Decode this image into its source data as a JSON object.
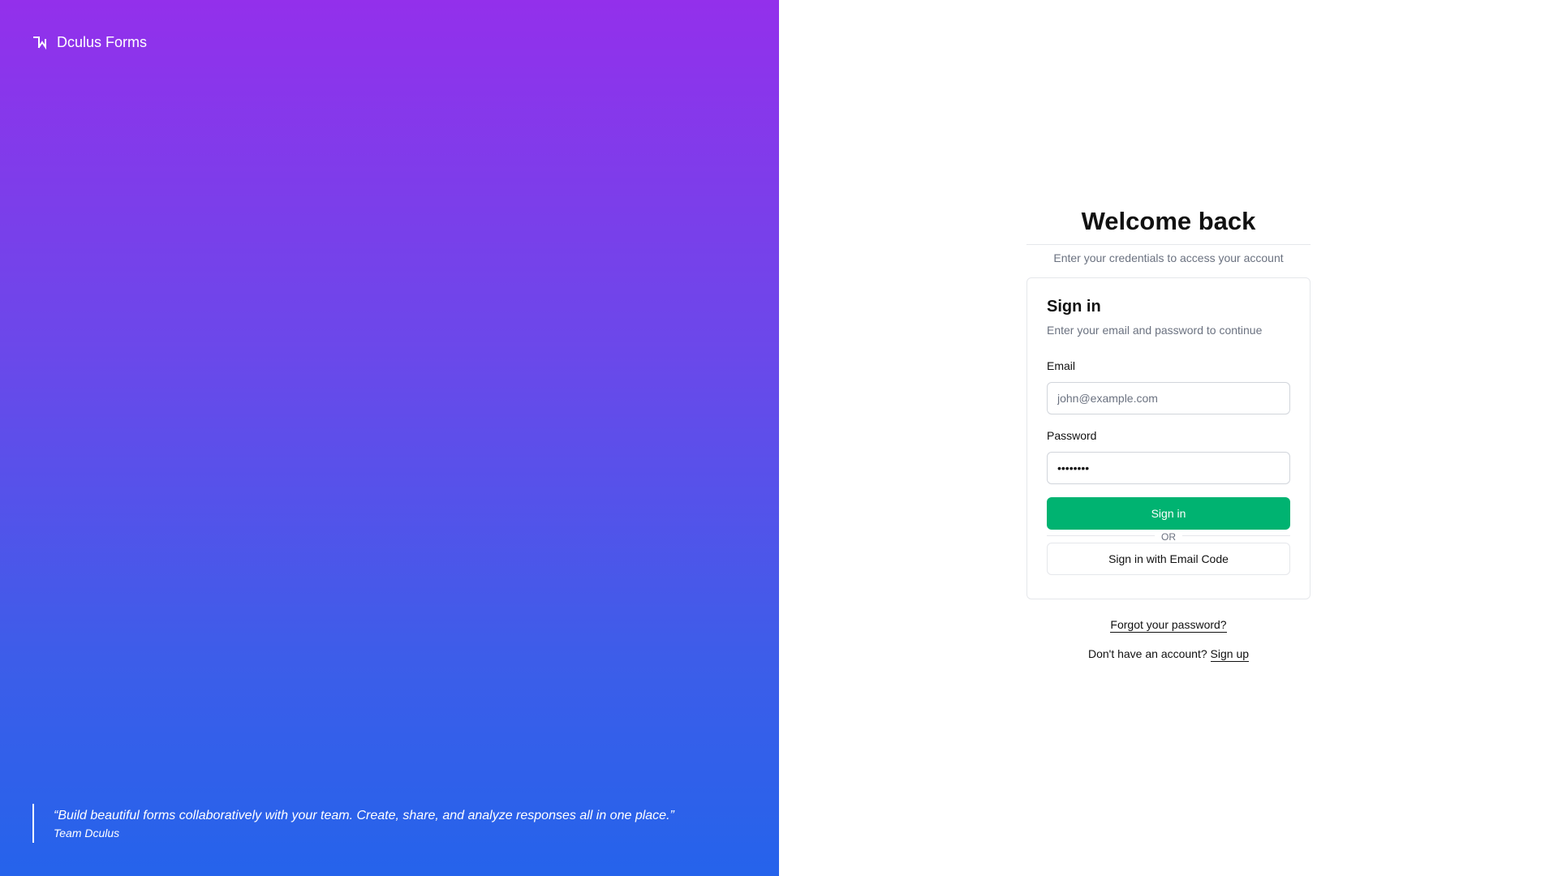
{
  "brand": {
    "name": "Dculus Forms",
    "icon": "brand-logo-icon"
  },
  "quote": {
    "text": "“Build beautiful forms collaboratively with your team. Create, share, and analyze responses all in one place.”",
    "author": "Team Dculus"
  },
  "header": {
    "title": "Welcome back",
    "subtitle": "Enter your credentials to access your account"
  },
  "card": {
    "title": "Sign in",
    "subtitle": "Enter your email and password to continue",
    "email_label": "Email",
    "email_placeholder": "john@example.com",
    "email_value": "",
    "password_label": "Password",
    "password_value": "password",
    "sign_in_label": "Sign in",
    "divider_label": "OR",
    "email_code_label": "Sign in with Email Code"
  },
  "footer": {
    "forgot_label": "Forgot your password?",
    "no_account_text": "Don't have an account?",
    "sign_up_label": "Sign up"
  },
  "colors": {
    "gradient_top": "#9330eb",
    "gradient_bottom": "#2563eb",
    "primary_button": "#00b371"
  }
}
